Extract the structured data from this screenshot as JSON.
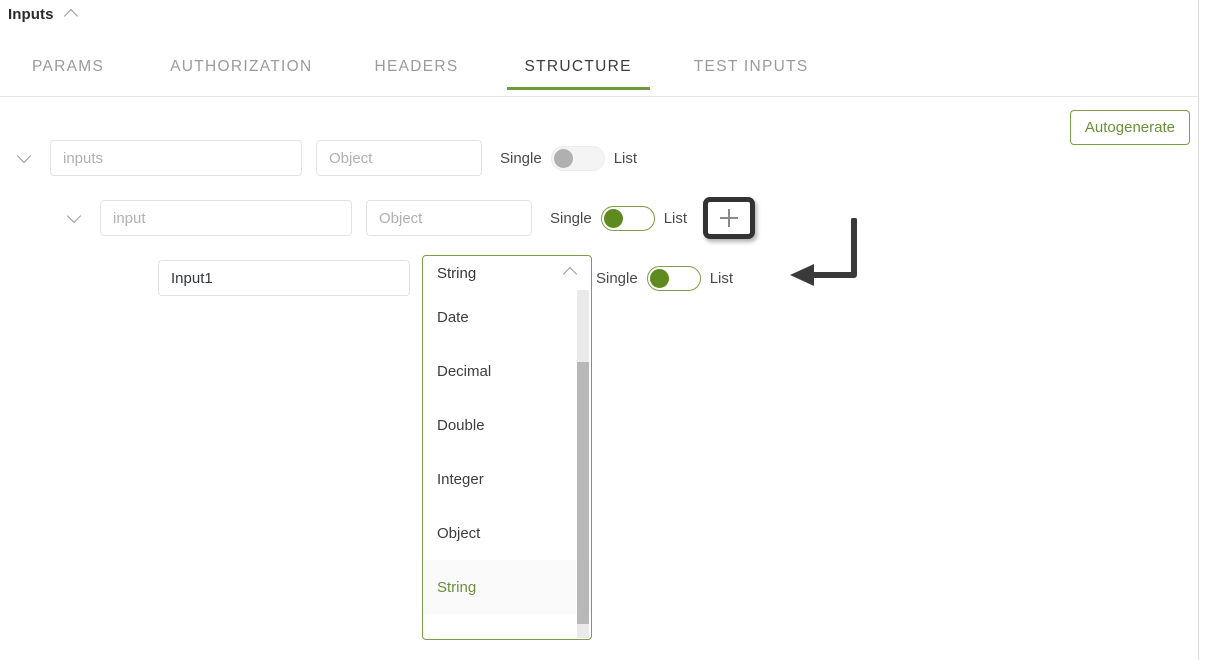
{
  "panel": {
    "title": "Inputs",
    "collapse_icon": "chevron-up-icon"
  },
  "tabs": [
    {
      "label": "PARAMS",
      "active": false
    },
    {
      "label": "AUTHORIZATION",
      "active": false
    },
    {
      "label": "HEADERS",
      "active": false
    },
    {
      "label": "STRUCTURE",
      "active": true
    },
    {
      "label": "TEST INPUTS",
      "active": false
    }
  ],
  "toolbar": {
    "autogenerate_label": "Autogenerate"
  },
  "labels": {
    "single": "Single",
    "list": "List",
    "add_icon": "plus-icon",
    "expander_icon": "chevron-down-icon"
  },
  "structure_rows": [
    {
      "level": 0,
      "name_value": "",
      "name_placeholder": "inputs",
      "type_value": "",
      "type_placeholder": "Object",
      "single_label": "Single",
      "list_label": "List",
      "toggle_state": "off",
      "has_add_button": false
    },
    {
      "level": 1,
      "name_value": "",
      "name_placeholder": "input",
      "type_value": "",
      "type_placeholder": "Object",
      "single_label": "Single",
      "list_label": "List",
      "toggle_state": "on",
      "has_add_button": true,
      "add_button_highlighted": true
    },
    {
      "level": 2,
      "name_value": "Input1",
      "name_placeholder": "",
      "type_value": "String",
      "type_placeholder": "",
      "single_label": "Single",
      "list_label": "List",
      "toggle_state": "on",
      "has_add_button": false,
      "dropdown_open": true
    }
  ],
  "type_dropdown": {
    "selected": "String",
    "chevron_icon": "chevron-up-icon",
    "options": [
      {
        "label": "Date",
        "selected": false
      },
      {
        "label": "Decimal",
        "selected": false
      },
      {
        "label": "Double",
        "selected": false
      },
      {
        "label": "Integer",
        "selected": false
      },
      {
        "label": "Object",
        "selected": false
      },
      {
        "label": "String",
        "selected": true
      }
    ]
  },
  "annotation": {
    "type": "elbow-arrow",
    "points_to": "List",
    "color": "#3a3a3a"
  },
  "colors": {
    "accent_green": "#6f9a3c",
    "toggle_on": "#5f8a20",
    "toggle_off": "#b0b0b0",
    "text_dark": "#33373c",
    "placeholder": "#b0b0b0",
    "border": "#e3e3e3",
    "annotation": "#3a3a3a"
  }
}
